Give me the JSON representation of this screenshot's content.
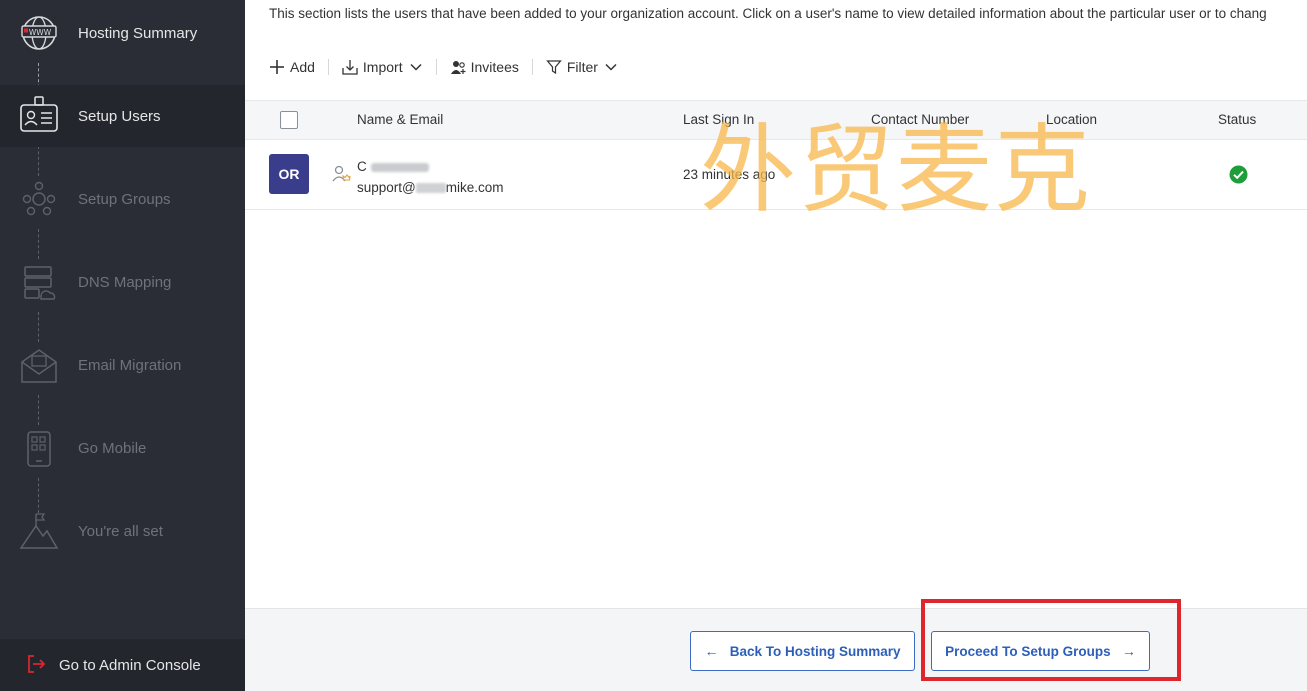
{
  "sidebar": {
    "steps": [
      {
        "label": "Hosting Summary",
        "icon": "globe-www-icon",
        "state": "done"
      },
      {
        "label": "Setup Users",
        "icon": "user-card-icon",
        "state": "active"
      },
      {
        "label": "Setup Groups",
        "icon": "group-icon",
        "state": "disabled"
      },
      {
        "label": "DNS Mapping",
        "icon": "dns-server-icon",
        "state": "disabled"
      },
      {
        "label": "Email Migration",
        "icon": "envelope-icon",
        "state": "disabled"
      },
      {
        "label": "Go Mobile",
        "icon": "mobile-icon",
        "state": "disabled"
      },
      {
        "label": "You're all set",
        "icon": "mountain-flag-icon",
        "state": "disabled"
      }
    ],
    "admin_console": {
      "label": "Go to Admin Console",
      "icon": "exit-icon"
    }
  },
  "main": {
    "description": "This section lists the users that have been added to your organization account. Click on a user's name to view detailed information about the particular user or to chang",
    "toolbar": {
      "add": "Add",
      "import": "Import",
      "invitees": "Invitees",
      "filter": "Filter"
    },
    "table": {
      "columns": [
        "Name & Email",
        "Last Sign In",
        "Contact Number",
        "Location",
        "Status"
      ],
      "rows": [
        {
          "avatar": "OR",
          "name": "C",
          "email_prefix": "support@",
          "email_suffix": "mike.com",
          "last_sign_in": "23 minutes ago",
          "contact_number": "",
          "location": "",
          "status": "active"
        }
      ]
    },
    "watermark": "外贸麦克",
    "footer": {
      "back_label": "Back To Hosting Summary",
      "proceed_label": "Proceed To Setup Groups"
    }
  },
  "colors": {
    "sidebar_bg": "#2a2d35",
    "avatar_bg": "#3a3d8c",
    "accent_blue": "#2d5fb8",
    "status_green": "#1f9d3a",
    "highlight_red": "#e0262d",
    "watermark": "#f9b84b"
  }
}
